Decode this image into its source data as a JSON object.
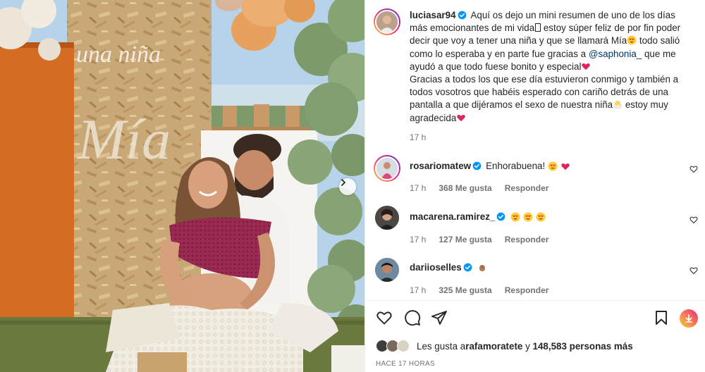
{
  "post": {
    "username": "luciasar94",
    "caption_p1_a": "Aquí os dejo un mini resumen de uno de los días más emocionantes de mi vida",
    "caption_p1_b": " estoy súper feliz de por fin poder decir que voy a tener una niña y que se llamará Mía",
    "caption_p1_c": " todo salió como lo esperaba y en parte fue gracias a ",
    "caption_mention": "@saphonia_",
    "caption_p1_d": " que me ayudó a que todo fuese bonito y especial",
    "caption_p2_a": "Gracias a todos los que ese día estuvieron conmigo y también a todos vosotros que habéis esperado con cariño detrás de una pantalla a que dijéramos el sexo de nuestra niña",
    "caption_p2_b": " estoy muy agradecida",
    "caption_time": "17 h",
    "likes_prefix": "Les gusta a ",
    "likes_user": "rafamoratete",
    "likes_middle": " y ",
    "likes_count": "148,583 personas más",
    "posted_ago": "HACE 17 HORAS"
  },
  "comments": [
    {
      "username": "rosariomatew",
      "text": "Enhorabuena!",
      "time": "17 h",
      "likes": "368 Me gusta",
      "reply": "Responder"
    },
    {
      "username": "macarena.ramirez_",
      "text": "",
      "time": "17 h",
      "likes": "127 Me gusta",
      "reply": "Responder"
    },
    {
      "username": "dariioselles",
      "text": "",
      "time": "17 h",
      "likes": "325 Me gusta",
      "reply": "Responder"
    }
  ],
  "photo": {
    "sign_text": "una niña",
    "name_text": "Mía"
  },
  "colors": {
    "link": "#00376b",
    "like_red": "#ed4956",
    "verified_blue": "#0095f6",
    "muted": "#737373"
  },
  "icons": [
    "verified-badge-icon",
    "heart-icon",
    "comment-icon",
    "share-icon",
    "save-icon",
    "chevron-right-icon"
  ]
}
